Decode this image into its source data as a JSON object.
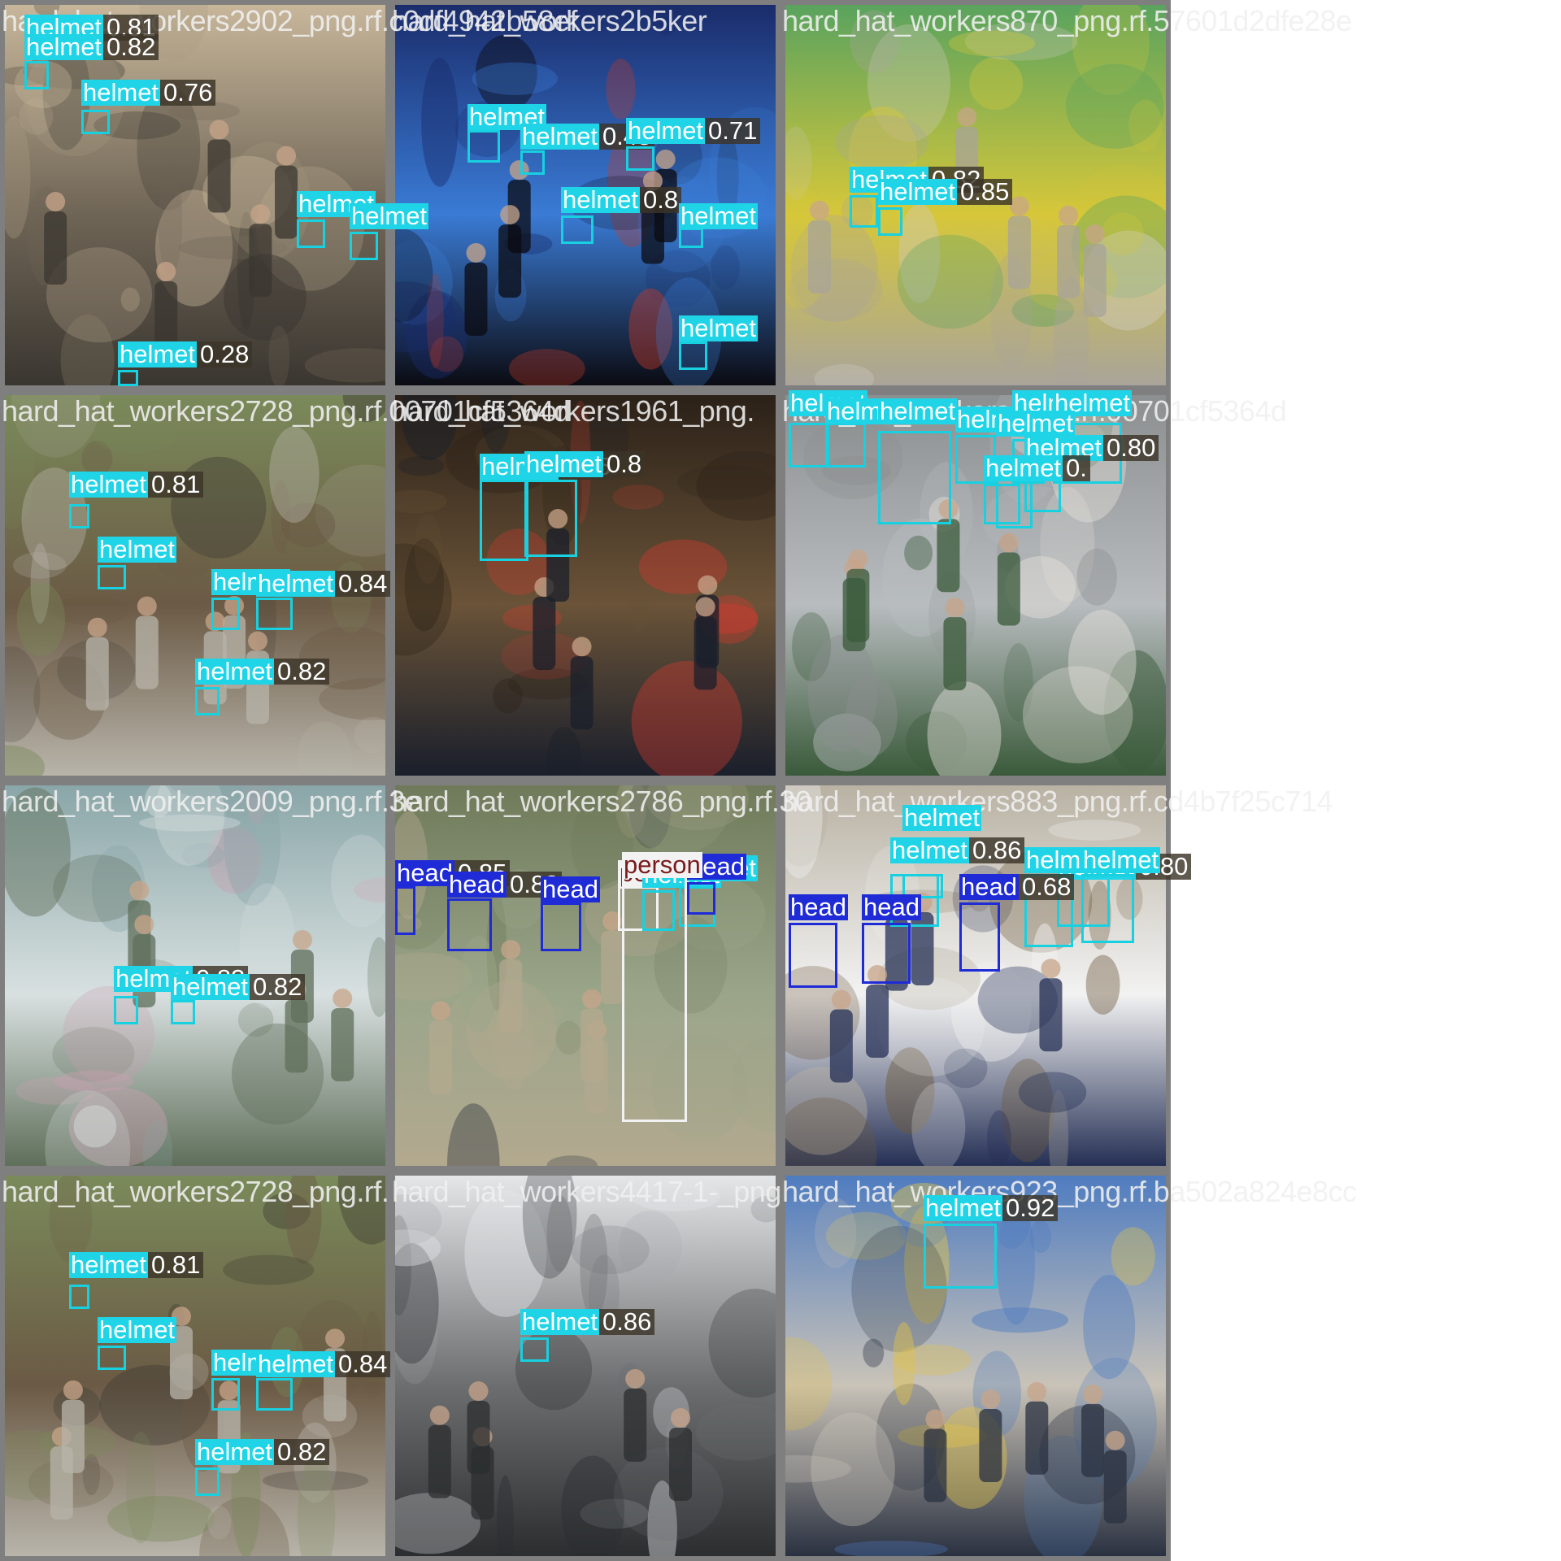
{
  "image_title": "",
  "tiles": [
    {
      "filename": "hard_hat_workers2902_png.rf.c0df4942b58ef",
      "palette": [
        "#c7b69a",
        "#6f6556",
        "#3a3630",
        "#a89a82"
      ],
      "detections": [
        {
          "cls": "helmet",
          "conf": "0.81"
        },
        {
          "cls": "helmet",
          "conf": "0.82"
        },
        {
          "cls": "helmet",
          "conf": "0.76"
        },
        {
          "cls": "helmet",
          "conf": ""
        },
        {
          "cls": "helmet",
          "conf": ""
        },
        {
          "cls": "helmet",
          "conf": "0.28"
        }
      ]
    },
    {
      "filename": "hard_hat_workers2b5ker",
      "palette": [
        "#1a2c6b",
        "#3a7bd5",
        "#0b0b12",
        "#c23a2a"
      ],
      "detections": [
        {
          "cls": "helmet",
          "conf": ""
        },
        {
          "cls": "helmet",
          "conf": "0.45"
        },
        {
          "cls": "helmet",
          "conf": "0.71"
        },
        {
          "cls": "helmet",
          "conf": "0.8"
        },
        {
          "cls": "helmet",
          "conf": ""
        },
        {
          "cls": "helmet",
          "conf": ""
        }
      ]
    },
    {
      "filename": "hard_hat_workers870_png.rf.57601d2dfe28e",
      "palette": [
        "#5aa35e",
        "#d6c73a",
        "#a9a49a",
        "#cfcac2"
      ],
      "detections": [
        {
          "cls": "helmet",
          "conf": "0.82"
        },
        {
          "cls": "helmet",
          "conf": "0.85"
        }
      ]
    },
    {
      "filename": "hard_hat_workers2728_png.rf.00701cf5364d",
      "palette": [
        "#7a8a5a",
        "#6b5a45",
        "#b8b4aa",
        "#3d3a33"
      ],
      "detections": [
        {
          "cls": "helmet",
          "conf": "0.81"
        },
        {
          "cls": "helmet",
          "conf": ""
        },
        {
          "cls": "helmet",
          "conf": ""
        },
        {
          "cls": "helmet",
          "conf": "0.84"
        },
        {
          "cls": "helmet",
          "conf": "0.82"
        }
      ]
    },
    {
      "filename": "hard_hat_workers1961_png.",
      "palette": [
        "#2b2118",
        "#6a5338",
        "#1a1f2b",
        "#d23a30"
      ],
      "detections": [
        {
          "cls": "helmet",
          "conf": "0.85"
        },
        {
          "cls": "helmet",
          "conf": "0.8"
        }
      ]
    },
    {
      "filename": "hard_hat_workers_png.rf.00701cf5364d",
      "palette": [
        "#8c8f90",
        "#b8bcbf",
        "#3a5a3a",
        "#e6e2dc"
      ],
      "detections": [
        {
          "cls": "helmet",
          "conf": ""
        },
        {
          "cls": "helmet",
          "conf": ""
        },
        {
          "cls": "helmet",
          "conf": ""
        },
        {
          "cls": "helmet",
          "conf": ""
        },
        {
          "cls": "helmet",
          "conf": ""
        },
        {
          "cls": "helmet",
          "conf": ""
        },
        {
          "cls": "helmet",
          "conf": "0.80"
        },
        {
          "cls": "helmet",
          "conf": ""
        },
        {
          "cls": "helmet",
          "conf": "0."
        }
      ]
    },
    {
      "filename": "hard_hat_workers2009_png.rf.3e",
      "palette": [
        "#8aa6a8",
        "#d8e0e0",
        "#5f6f5a",
        "#c7a0b0"
      ],
      "detections": [
        {
          "cls": "helmet",
          "conf": "0.83"
        },
        {
          "cls": "helmet",
          "conf": "0.82"
        }
      ]
    },
    {
      "filename": "hard_hat_workers2786_png.rf.30",
      "palette": [
        "#6f7a5a",
        "#9aa58a",
        "#b3a98f",
        "#2e3340"
      ],
      "detections": [
        {
          "cls": "head",
          "conf": "0.85"
        },
        {
          "cls": "head",
          "conf": "0.83"
        },
        {
          "cls": "head",
          "conf": ""
        },
        {
          "cls": "person",
          "conf": ""
        },
        {
          "cls": "helmet",
          "conf": ""
        },
        {
          "cls": "helmet",
          "conf": ""
        },
        {
          "cls": "head",
          "conf": ""
        },
        {
          "cls": "person",
          "conf": ""
        }
      ]
    },
    {
      "filename": "hard_hat_workers883_png.rf.cd4b7f25c714",
      "palette": [
        "#b9b2a3",
        "#f2f2f2",
        "#253055",
        "#6f5b3e"
      ],
      "detections": [
        {
          "cls": "helmet",
          "conf": "0.86"
        },
        {
          "cls": "helmet",
          "conf": ""
        },
        {
          "cls": "helmet",
          "conf": "0.80"
        },
        {
          "cls": "helmet",
          "conf": "0.78"
        },
        {
          "cls": "helmet",
          "conf": ""
        },
        {
          "cls": "head",
          "conf": ""
        },
        {
          "cls": "head",
          "conf": ""
        },
        {
          "cls": "head",
          "conf": "0.68"
        }
      ]
    },
    {
      "filename": "hard_hat_workers2728_png.rf.",
      "palette": [
        "#7a8a5a",
        "#6b5a45",
        "#b8b4aa",
        "#3d3a33"
      ],
      "detections": [
        {
          "cls": "helmet",
          "conf": "0.81"
        },
        {
          "cls": "helmet",
          "conf": ""
        },
        {
          "cls": "helmet",
          "conf": ""
        },
        {
          "cls": "helmet",
          "conf": "0.84"
        },
        {
          "cls": "helmet",
          "conf": "0.82"
        }
      ]
    },
    {
      "filename": "hard_hat_workers4417-1-_png",
      "palette": [
        "#e4e6e8",
        "#6c6e70",
        "#2b2d2f",
        "#a8aaac"
      ],
      "detections": [
        {
          "cls": "helmet",
          "conf": "0.86"
        }
      ]
    },
    {
      "filename": "hard_hat_workers923_png.rf.ba502a824e8cc",
      "palette": [
        "#4f7cc0",
        "#c9c3b8",
        "#2a3140",
        "#e0c24a"
      ],
      "detections": [
        {
          "cls": "helmet",
          "conf": "0.92"
        }
      ]
    }
  ]
}
